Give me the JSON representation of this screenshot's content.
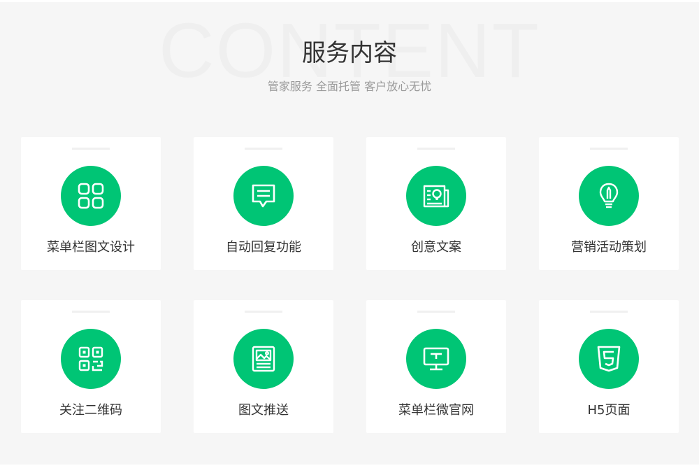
{
  "header": {
    "watermark": "CONTENT",
    "title": "服务内容",
    "subtitle": "管家服务 全面托管 客户放心无忧"
  },
  "theme": {
    "accent": "#00c575",
    "card_bg": "#ffffff",
    "page_bg": "#f6f6f6"
  },
  "services": [
    {
      "label": "菜单栏图文设计",
      "icon": "grid-icon"
    },
    {
      "label": "自动回复功能",
      "icon": "chat-bubble-icon"
    },
    {
      "label": "创意文案",
      "icon": "idea-document-icon"
    },
    {
      "label": "营销活动策划",
      "icon": "lightbulb-pencil-icon"
    },
    {
      "label": "关注二维码",
      "icon": "qr-code-icon"
    },
    {
      "label": "图文推送",
      "icon": "image-article-icon"
    },
    {
      "label": "菜单栏微官网",
      "icon": "monitor-icon"
    },
    {
      "label": "H5页面",
      "icon": "html5-icon"
    }
  ]
}
